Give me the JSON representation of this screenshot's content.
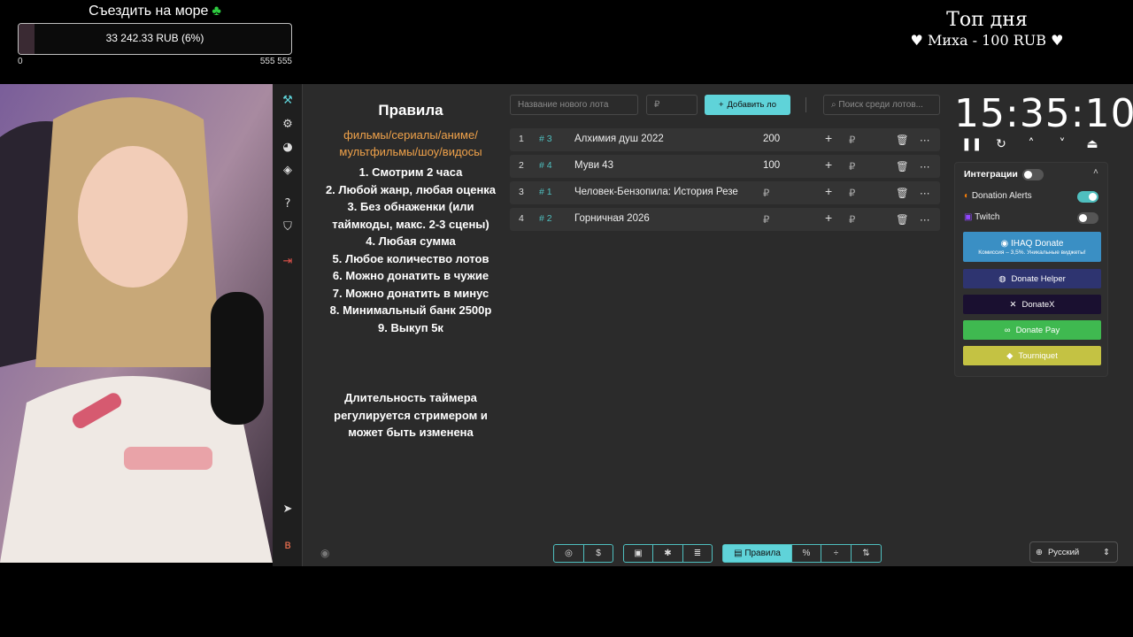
{
  "goal": {
    "title": "Съездить на море",
    "current": "33 242.33 RUB (6%)",
    "progress_percent": 6,
    "min": "0",
    "max": "555 555"
  },
  "top_day": {
    "title": "Топ дня",
    "entry": "Миха - 100 RUB"
  },
  "rules": {
    "title": "Правила",
    "categories": "фильмы/сериалы/аниме/ мультфильмы/шоу/видосы",
    "items": [
      "1. Смотрим 2 часа",
      "2. Любой жанр, любая оценка",
      "3. Без обнаженки (или таймкоды, макс. 2-3 сцены)",
      "4. Любая сумма",
      "5. Любое количество лотов",
      "6. Можно донатить в чужие",
      "7. Можно донатить в минус",
      "8. Минимальный банк 2500р",
      "9. Выкуп 5к"
    ],
    "note": "Длительность таймера регулируется стримером и может быть изменена"
  },
  "toolbar": {
    "new_lot_placeholder": "Название нового лота",
    "amount_placeholder": "₽",
    "add_label": "Добавить ло",
    "search_placeholder": "Поиск среди лотов..."
  },
  "lots": [
    {
      "num": "1",
      "id": "# 3",
      "name": "Алхимия душ 2022",
      "amount": "200",
      "currency": "₽"
    },
    {
      "num": "2",
      "id": "# 4",
      "name": "Муви 43",
      "amount": "100",
      "currency": "₽"
    },
    {
      "num": "3",
      "id": "# 1",
      "name": "Человек-Бензопила: История Резе",
      "amount": "₽",
      "currency": "₽"
    },
    {
      "num": "4",
      "id": "# 2",
      "name": "Горничная 2026",
      "amount": "₽",
      "currency": "₽"
    }
  ],
  "timer": {
    "value": "15:35:10"
  },
  "integrations": {
    "title": "Интеграции",
    "donation_alerts": "Donation Alerts",
    "twitch": "Twitch",
    "services": [
      {
        "label": "IHAQ Donate",
        "sub": "Комиссия – 3,5%. Уникальные виджеты!",
        "color": "#3a8fc4"
      },
      {
        "label": "Donate Helper",
        "color": "#2e3470"
      },
      {
        "label": "DonateX",
        "color": "#1a1030"
      },
      {
        "label": "Donate Pay",
        "color": "#3fb950"
      },
      {
        "label": "Tourniquet",
        "color": "#c4c243"
      }
    ]
  },
  "footer": {
    "rules_label": "Правила",
    "language": "Русский"
  }
}
